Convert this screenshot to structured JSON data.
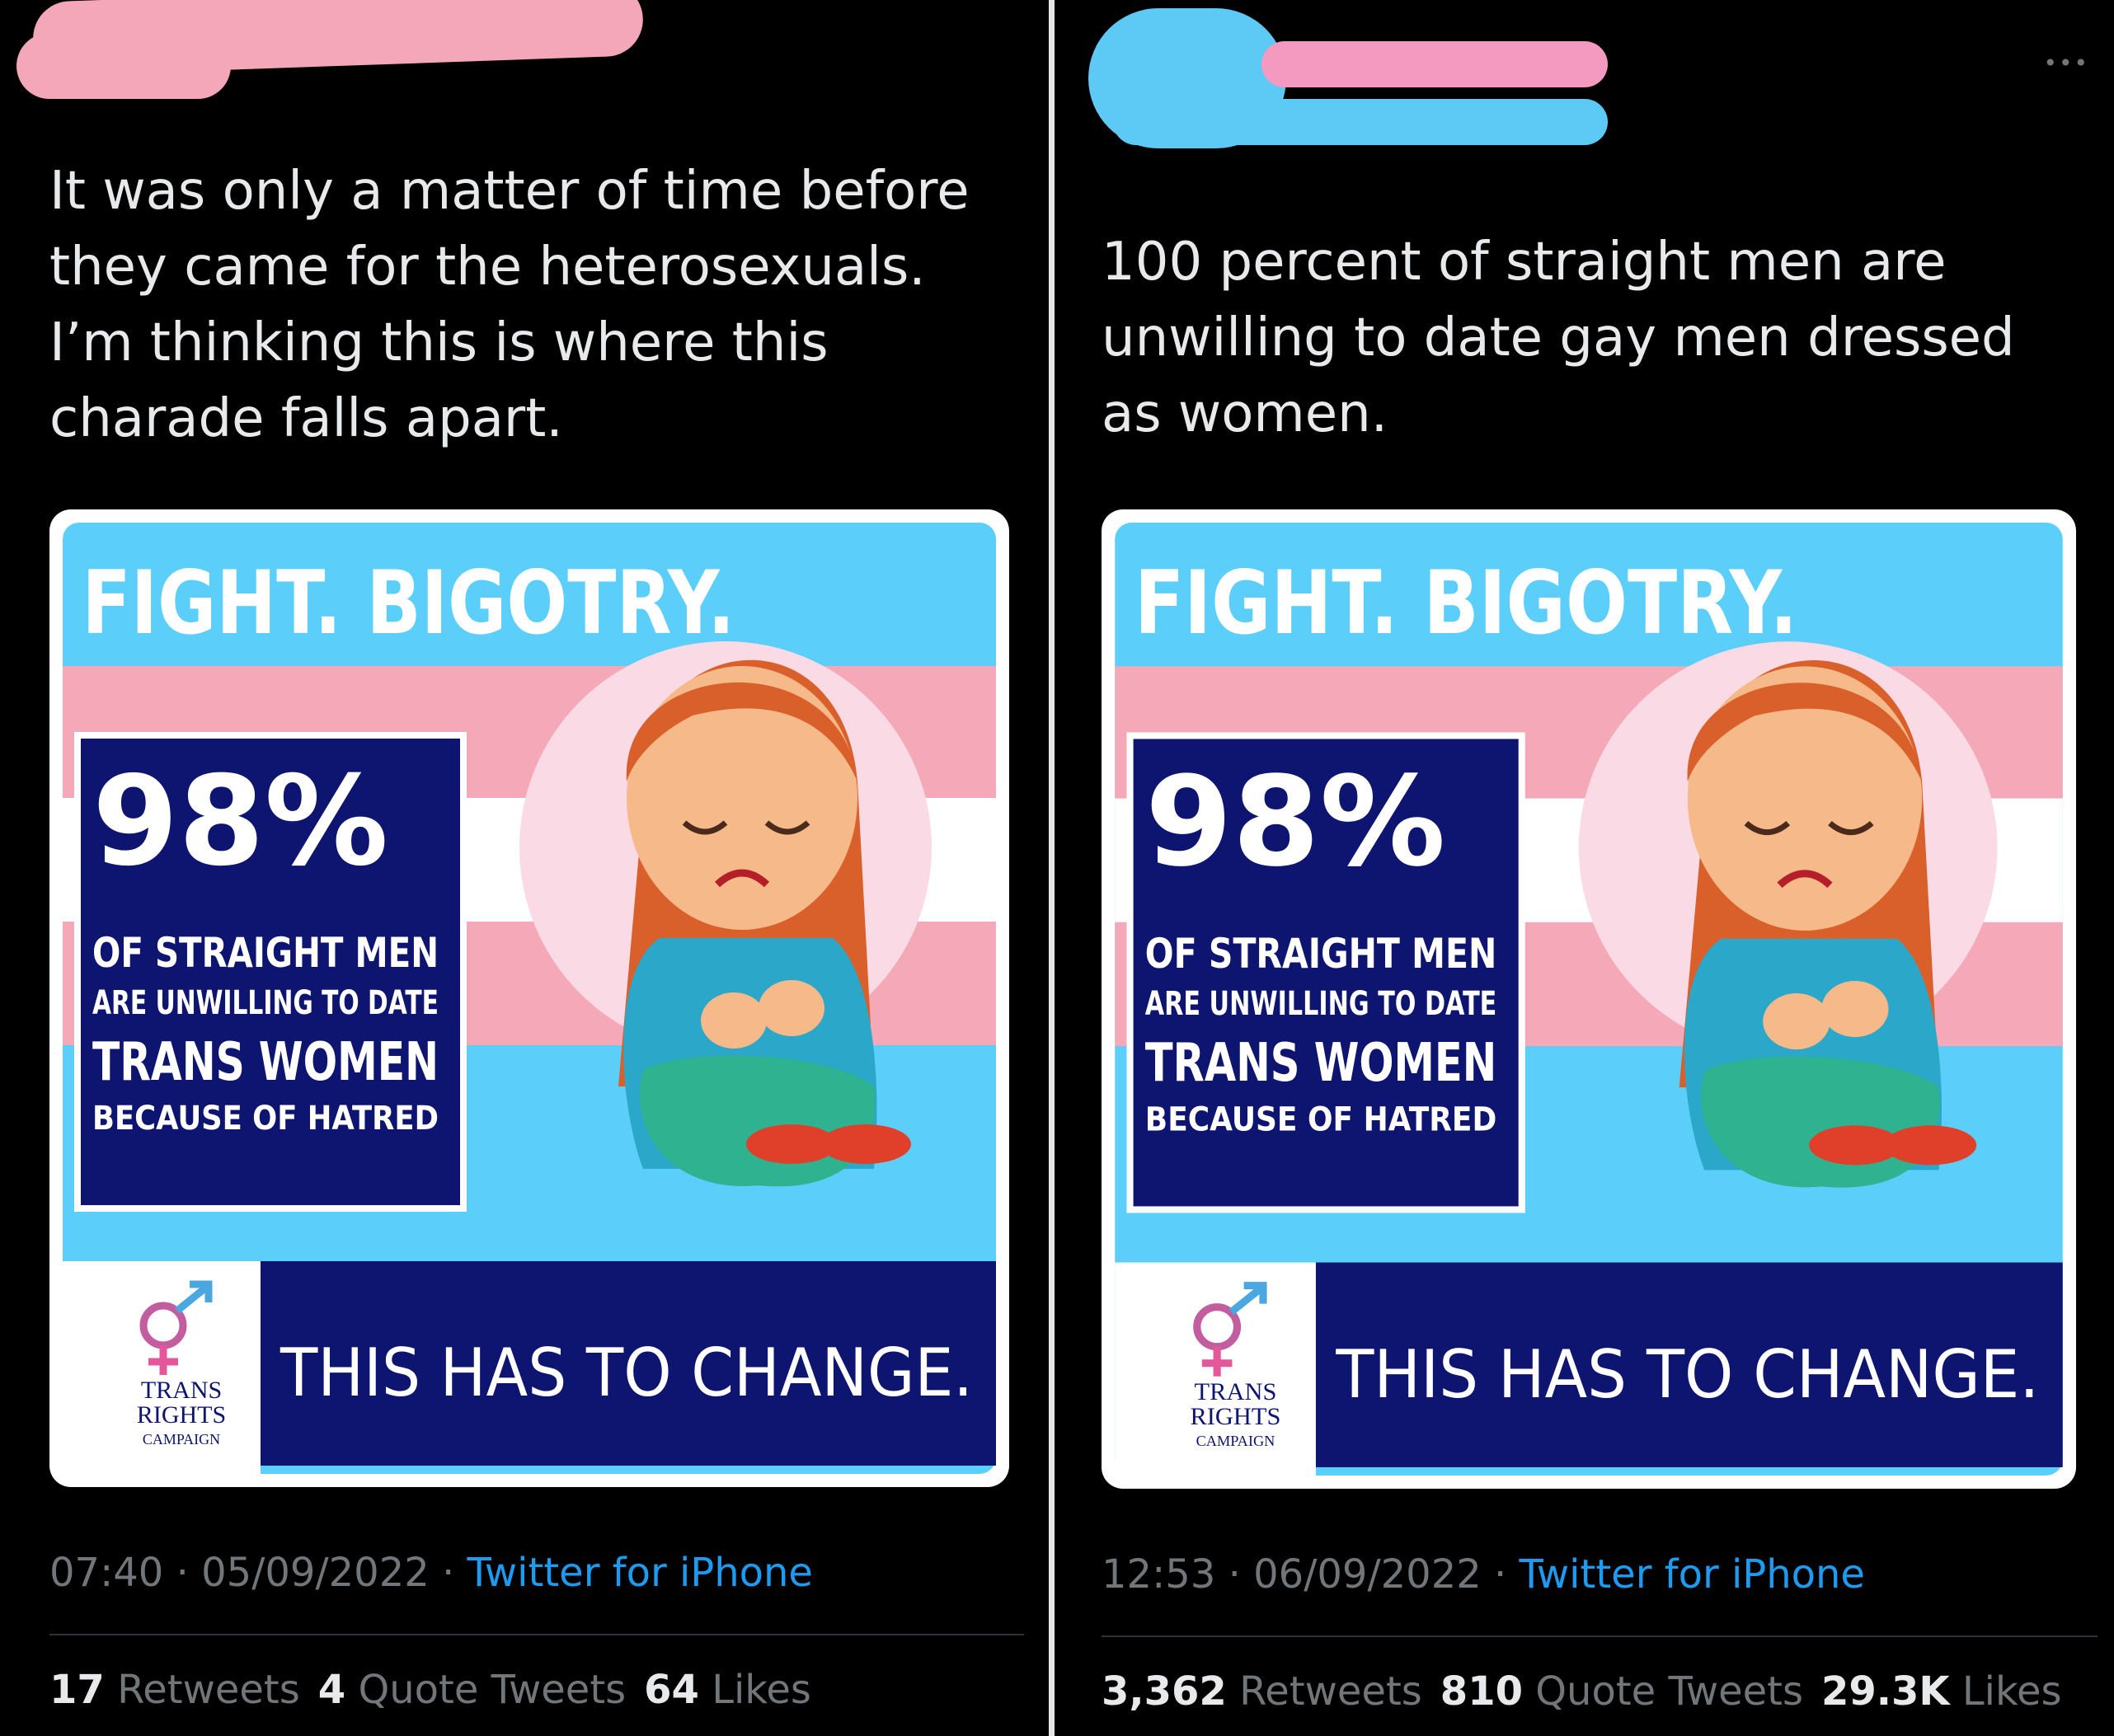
{
  "tweets": [
    {
      "text": "It was only a matter of time before they came for the heterosexuals. I’m thinking this is where this charade falls apart.",
      "image": {
        "headline": "FIGHT. BIGOTRY.",
        "percent": "98%",
        "line1": "OF STRAIGHT MEN",
        "line2": "ARE UNWILLING TO DATE",
        "line3": "TRANS WOMEN",
        "line4": "BECAUSE OF HATRED",
        "banner": "THIS HAS TO CHANGE.",
        "logo_line1": "TRANS",
        "logo_line2": "RIGHTS",
        "logo_line3": "CAMPAIGN"
      },
      "time": "07:40",
      "date": "05/09/2022",
      "source": "Twitter for iPhone",
      "retweets_count": "17",
      "retweets_label": "Retweets",
      "quotes_count": "4",
      "quotes_label": "Quote Tweets",
      "likes_count": "64",
      "likes_label": "Likes"
    },
    {
      "text": "100 percent of straight men are unwilling to date gay men dressed as women.",
      "image": {
        "headline": "FIGHT. BIGOTRY.",
        "percent": "98%",
        "line1": "OF STRAIGHT MEN",
        "line2": "ARE UNWILLING TO DATE",
        "line3": "TRANS WOMEN",
        "line4": "BECAUSE OF HATRED",
        "banner": "THIS HAS TO CHANGE.",
        "logo_line1": "TRANS",
        "logo_line2": "RIGHTS",
        "logo_line3": "CAMPAIGN"
      },
      "time": "12:53",
      "date": "06/09/2022",
      "source": "Twitter for iPhone",
      "retweets_count": "3,362",
      "retweets_label": "Retweets",
      "quotes_count": "810",
      "quotes_label": "Quote Tweets",
      "likes_count": "29.3K",
      "likes_label": "Likes"
    }
  ],
  "more_icon": "ellipsis-icon",
  "colors": {
    "flag_blue": "#5bcefa",
    "flag_pink": "#f5a9b8",
    "navy": "#0d1570",
    "link_blue": "#1d9bf0",
    "muted": "#71767b"
  }
}
